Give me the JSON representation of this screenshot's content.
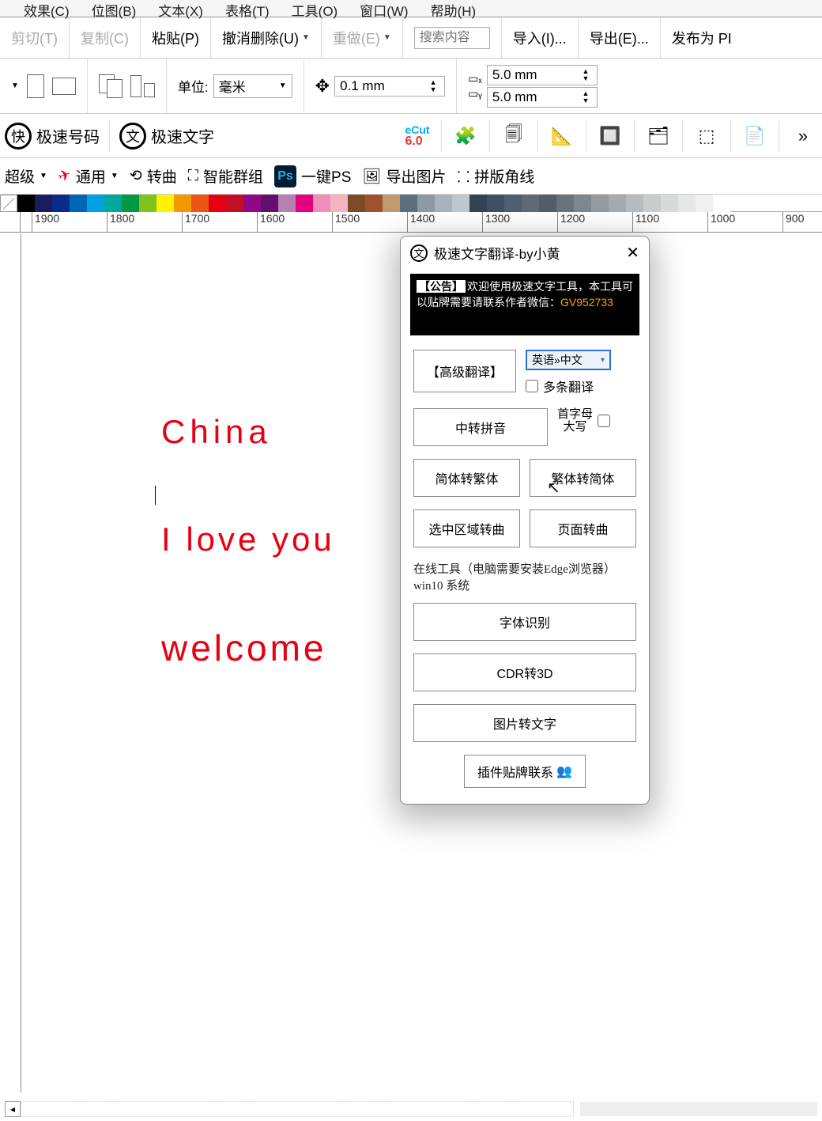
{
  "menu": {
    "effects": "效果(C)",
    "bitmap": "位图(B)",
    "text": "文本(X)",
    "table": "表格(T)",
    "tools": "工具(O)",
    "window": "窗口(W)",
    "help": "帮助(H)"
  },
  "std": {
    "cut": "剪切(T)",
    "copy": "复制(C)",
    "paste": "粘贴(P)",
    "undo": "撤消删除(U)",
    "redo": "重做(E)",
    "searchPh": "搜索内容",
    "import": "导入(I)...",
    "export": "导出(E)...",
    "publish": "发布为 PI"
  },
  "prop": {
    "unitLbl": "单位:",
    "unitVal": "毫米",
    "nudge": "0.1 mm",
    "dupx": "5.0 mm",
    "dupy": "5.0 mm"
  },
  "row1": {
    "num": "极速号码",
    "txt": "极速文字",
    "ecut": "eCut",
    "ecutv": "6.0",
    "more": "»"
  },
  "row2": {
    "super": "超级",
    "general": "通用",
    "curve": "转曲",
    "group": "智能群组",
    "ps": "一键PS",
    "export": "导出图片",
    "corner": "拼版角线"
  },
  "palette": [
    "#000000",
    "#1b1b5f",
    "#0a2a8c",
    "#0066b3",
    "#00a0e3",
    "#00a99d",
    "#009944",
    "#7fc31c",
    "#fff100",
    "#f39800",
    "#ea5514",
    "#e60012",
    "#c30d23",
    "#920783",
    "#640f6c",
    "#b77fb4",
    "#e4007f",
    "#ef8fbb",
    "#f5b2c0",
    "#7c4b26",
    "#a0522d",
    "#c19a6b",
    "#5c6f7e",
    "#8e99a3",
    "#a9b3bd",
    "#c0c8cf",
    "#324354",
    "#3e5063",
    "#4d5f72",
    "#606a76",
    "#545d66",
    "#6a737c",
    "#7e868e",
    "#949ba1",
    "#a6abb0",
    "#b7bcc0",
    "#c8ccce",
    "#d7d9db",
    "#e6e7e8",
    "#f0f0f0",
    "#ffffff"
  ],
  "ruler": [
    1900,
    1800,
    1700,
    1600,
    1500,
    1400,
    1300,
    1200,
    1100,
    1000,
    900
  ],
  "canvasText": {
    "t1": "China",
    "t2": "I love you",
    "t3": "welcome"
  },
  "dlg": {
    "title": "极速文字翻译-by小黄",
    "bannerTag": "【公告】",
    "bannerL1": "欢迎使用极速文字工具，本工具可",
    "bannerL2": "以贴牌需要请联系作者微信：",
    "bannerWx": "GV952733",
    "advTrans": "【高级翻译】",
    "langSel": "英语»中文",
    "multi": "多条翻译",
    "pinyin": "中转拼音",
    "capLbl": "首字母\n大写",
    "s2t": "简体转繁体",
    "t2s": "繁体转简体",
    "selCurve": "选中区域转曲",
    "pageCurve": "页面转曲",
    "note": "在线工具（电脑需要安装Edge浏览器）win10 系统",
    "fontDetect": "字体识别",
    "cdr3d": "CDR转3D",
    "img2text": "图片转文字",
    "contact": "插件贴牌联系"
  }
}
